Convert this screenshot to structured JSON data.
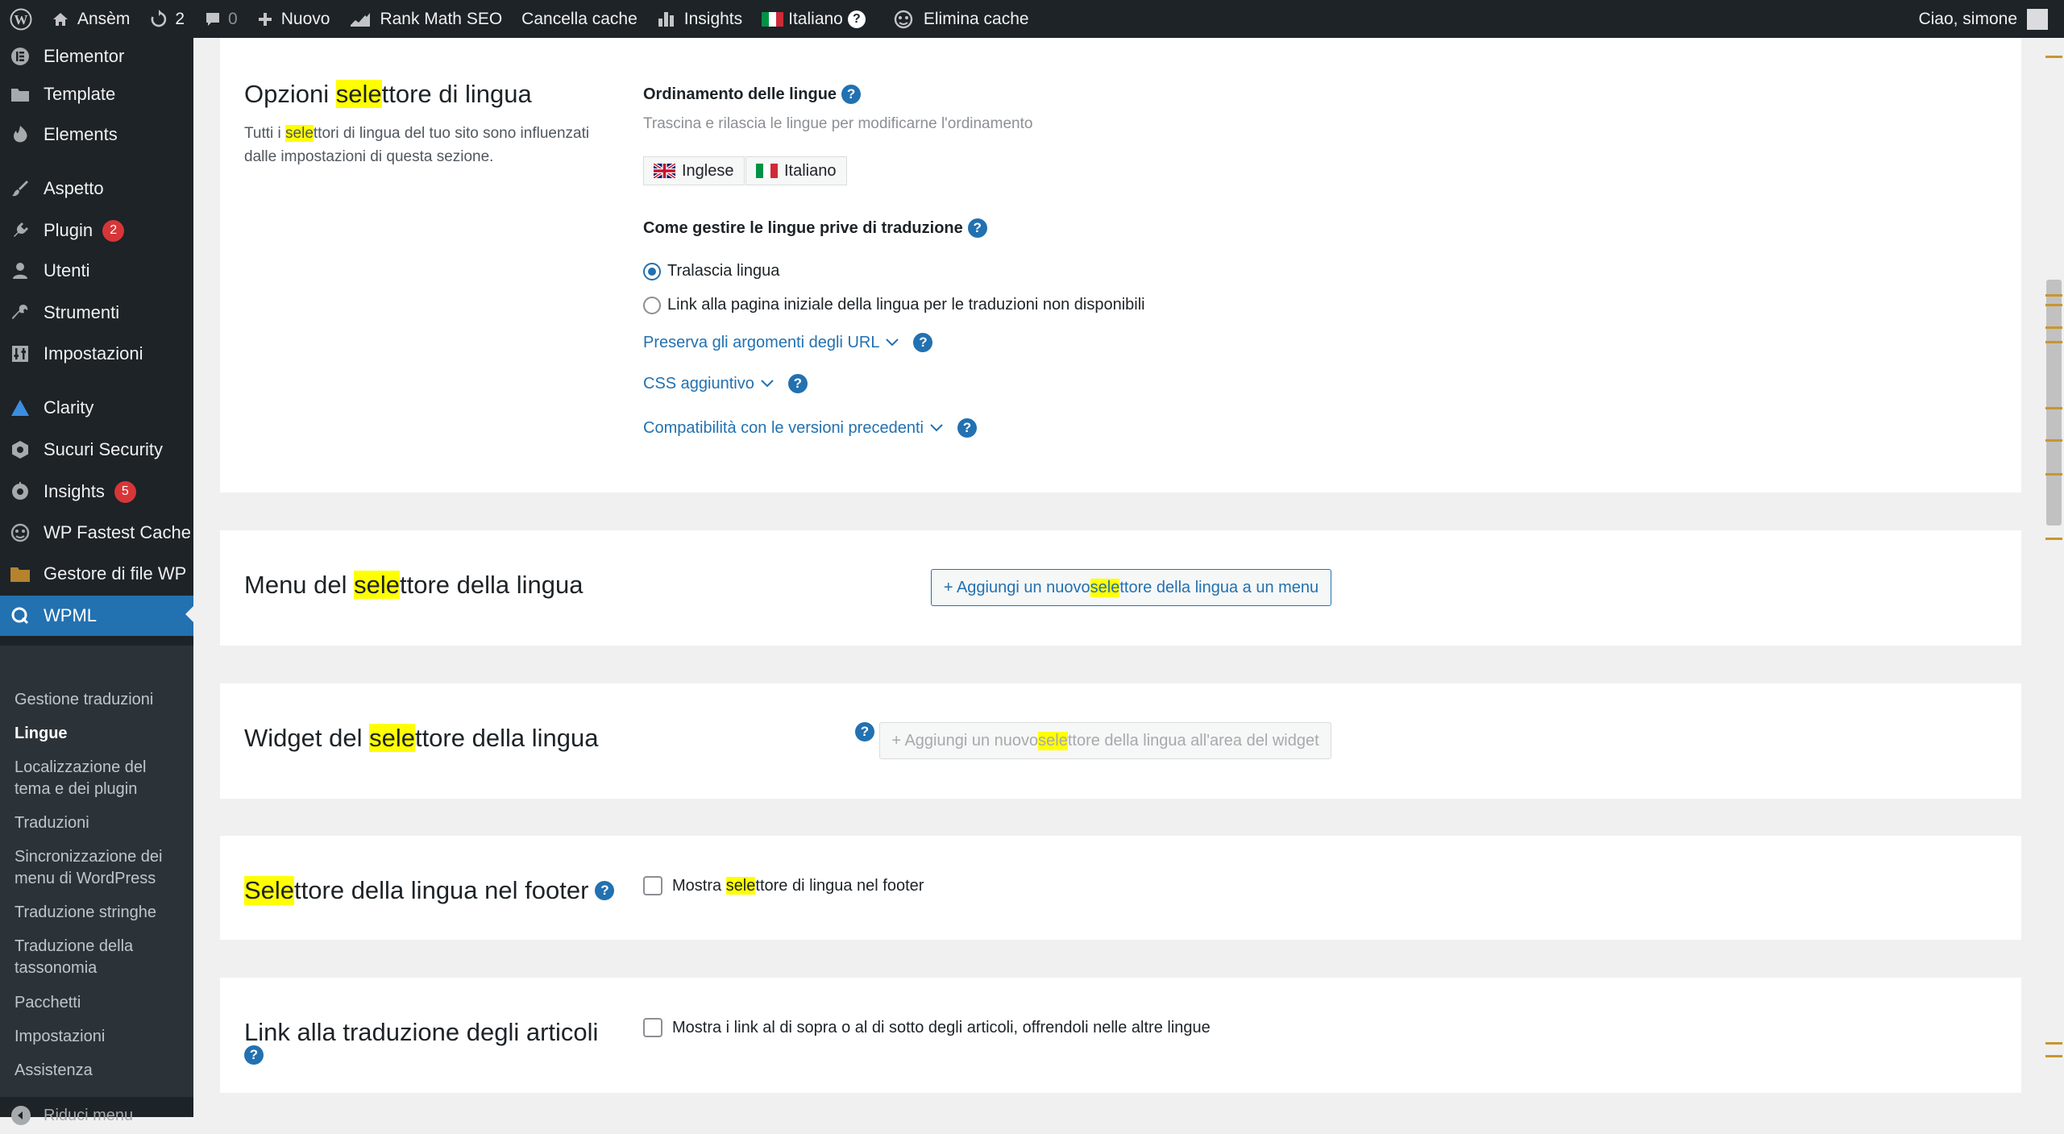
{
  "admin_bar": {
    "site_name": "Ansèm",
    "updates_count": "2",
    "comments_count": "0",
    "new_label": "Nuovo",
    "rank_math": "Rank Math SEO",
    "clear_cache": "Cancella cache",
    "insights": "Insights",
    "language": "Italiano",
    "language_help": "?",
    "delete_cache": "Elimina cache",
    "greeting": "Ciao, simone"
  },
  "sidebar": {
    "items": [
      {
        "label": "Elementor",
        "icon": "elementor-icon"
      },
      {
        "label": "Template",
        "icon": "folder-icon"
      },
      {
        "label": "Elements",
        "icon": "elements-icon"
      },
      {
        "label": "Aspetto",
        "icon": "brush-icon"
      },
      {
        "label": "Plugin",
        "icon": "plug-icon",
        "badge": "2"
      },
      {
        "label": "Utenti",
        "icon": "user-icon"
      },
      {
        "label": "Strumenti",
        "icon": "wrench-icon"
      },
      {
        "label": "Impostazioni",
        "icon": "settings-icon"
      },
      {
        "label": "Clarity",
        "icon": "clarity-icon"
      },
      {
        "label": "Sucuri Security",
        "icon": "sucuri-icon"
      },
      {
        "label": "Insights",
        "icon": "insights-icon",
        "badge": "5"
      },
      {
        "label": "WP Fastest Cache",
        "icon": "cheetah-icon"
      },
      {
        "label": "Gestore di file WP",
        "icon": "file-manager-icon"
      },
      {
        "label": "WPML",
        "icon": "wpml-icon"
      }
    ],
    "submenu": [
      {
        "label": "Gestione traduzioni"
      },
      {
        "label": "Lingue"
      },
      {
        "label": "Localizzazione del tema e dei plugin"
      },
      {
        "label": "Traduzioni"
      },
      {
        "label": "Sincronizzazione dei menu di WordPress"
      },
      {
        "label": "Traduzione stringhe"
      },
      {
        "label": "Traduzione della tassonomia"
      },
      {
        "label": "Pacchetti"
      },
      {
        "label": "Impostazioni"
      },
      {
        "label": "Assistenza"
      }
    ],
    "collapse_label": "Riduci menu"
  },
  "search_highlight": "sele",
  "options_section": {
    "title_pre": "Opzioni ",
    "title_hl": "sele",
    "title_post": "ttore di lingua",
    "desc_pre": "Tutti i ",
    "desc_hl": "sele",
    "desc_post": "ttori di lingua del tuo sito sono influenzati dalle impostazioni di questa sezione.",
    "order_label": "Ordinamento delle lingue",
    "order_hint": "Trascina e rilascia le lingue per modificarne l'ordinamento",
    "languages": [
      "Inglese",
      "Italiano"
    ],
    "untranslated_label": "Come gestire le lingue prive di traduzione",
    "radio_skip": "Tralascia lingua",
    "radio_link": "Link alla pagina iniziale della lingua per le traduzioni non disponibili",
    "preserve_url": "Preserva gli argomenti degli URL",
    "additional_css": "CSS aggiuntivo",
    "backward_compat": "Compatibilità con le versioni precedenti",
    "help": "?"
  },
  "menu_section": {
    "title_pre": "Menu del ",
    "title_hl": "sele",
    "title_post": "ttore della lingua",
    "button_pre": "+ Aggiungi un nuovo ",
    "button_hl": "sele",
    "button_post": "ttore della lingua a un menu"
  },
  "widget_section": {
    "title_pre": "Widget del ",
    "title_hl": "sele",
    "title_post": "ttore della lingua",
    "button_pre": "+ Aggiungi un nuovo ",
    "button_hl": "sele",
    "button_post": "ttore della lingua all'area del widget"
  },
  "footer_section": {
    "title_hl": "Sele",
    "title_post": "ttore della lingua nel footer",
    "check_pre": "Mostra ",
    "check_hl": "sele",
    "check_post": "ttore di lingua nel footer"
  },
  "posts_section": {
    "title": "Link alla traduzione degli articoli",
    "check_label": "Mostra i link al di sopra o al di sotto degli articoli, offrendoli nelle altre lingue"
  },
  "colors": {
    "admin_bar": "#1d2327",
    "accent": "#2271b1",
    "highlight": "#ffff00",
    "badge": "#d63638"
  }
}
